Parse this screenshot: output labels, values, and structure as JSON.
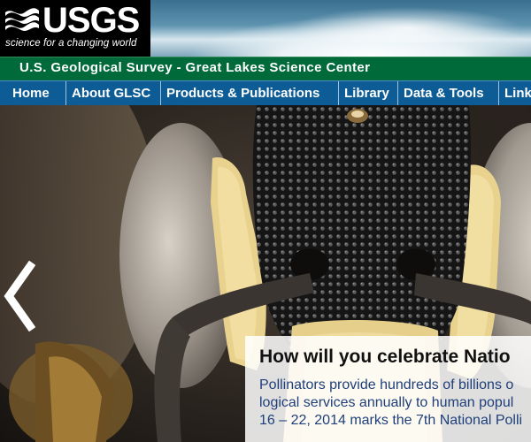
{
  "brand": {
    "logo_text": "USGS",
    "tagline": "science for a changing world"
  },
  "site": {
    "title": "U.S. Geological Survey - Great Lakes Science Center"
  },
  "nav": {
    "items": [
      {
        "label": "Home"
      },
      {
        "label": "About GLSC"
      },
      {
        "label": "Products & Publications"
      },
      {
        "label": "Library"
      },
      {
        "label": "Data & Tools"
      },
      {
        "label": "Link"
      }
    ]
  },
  "slideshow": {
    "title": "How will you celebrate Natio",
    "body_lines": [
      "Pollinators provide hundreds of billions o",
      "logical services annually to human popul",
      "16 – 22, 2014 marks the 7th National Polli"
    ],
    "prev_icon": "chevron-left-icon"
  },
  "colors": {
    "green_bar": "#006a3a",
    "nav_blue": "#0d5c96"
  }
}
